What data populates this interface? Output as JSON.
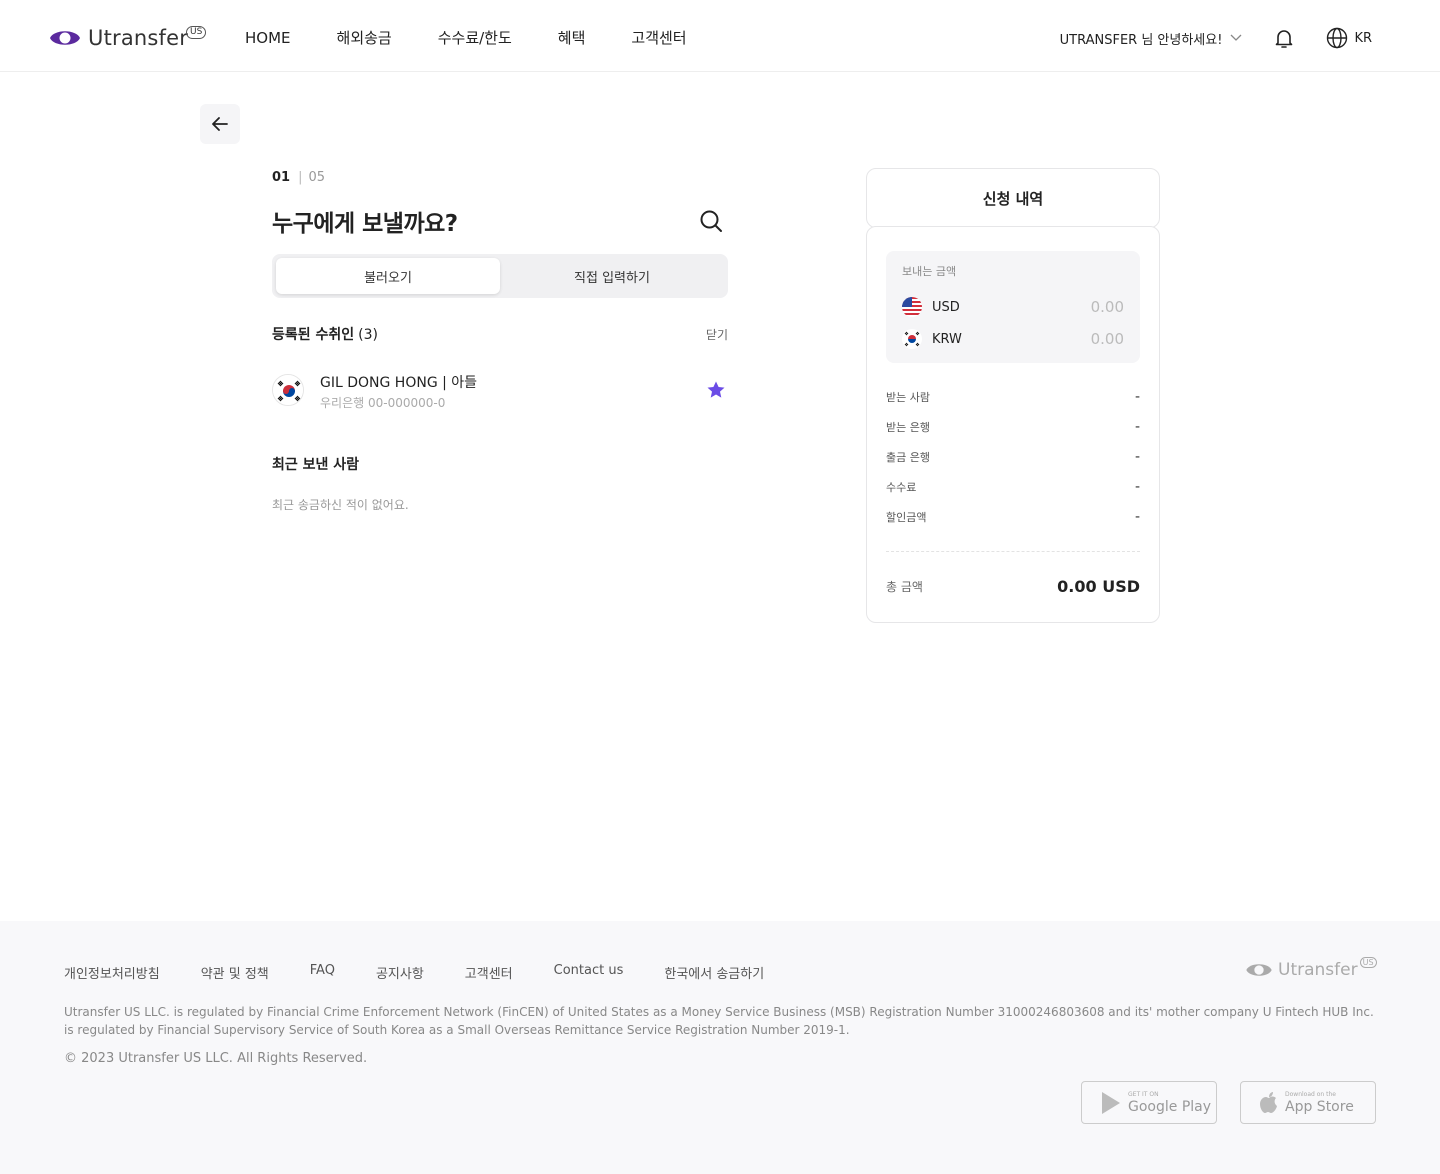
{
  "header": {
    "logo_text": "Utransfer",
    "logo_badge": "US",
    "nav": [
      "HOME",
      "해외송금",
      "수수료/한도",
      "혜택",
      "고객센터"
    ],
    "greeting": "UTRANSFER 님 안녕하세요!",
    "language": "KR"
  },
  "step": {
    "current": "01",
    "separator": "|",
    "total": "05"
  },
  "title": "누구에게 보낼까요?",
  "tabs": {
    "load": "불러오기",
    "manual": "직접 입력하기"
  },
  "registered": {
    "title": "등록된 수취인",
    "count": "(3)",
    "close_label": "닫기",
    "recipients": [
      {
        "name": "GIL DONG HONG | 아들",
        "bank": "우리은행 00-000000-0"
      }
    ]
  },
  "recent": {
    "title": "최근 보낸 사람",
    "empty": "최근 송금하신 적이 없어요."
  },
  "summary": {
    "title": "신청 내역",
    "send_amount_label": "보내는 금액",
    "currencies": [
      {
        "code": "USD",
        "amount": "0.00"
      },
      {
        "code": "KRW",
        "amount": "0.00"
      }
    ],
    "rows": [
      {
        "label": "받는 사람",
        "value": "-"
      },
      {
        "label": "받는 은행",
        "value": "-"
      },
      {
        "label": "출금 은행",
        "value": "-"
      },
      {
        "label": "수수료",
        "value": "-"
      },
      {
        "label": "할인금액",
        "value": "-"
      }
    ],
    "total_label": "총 금액",
    "total_value": "0.00 USD"
  },
  "footer": {
    "links": [
      "개인정보처리방침",
      "약관 및 정책",
      "FAQ",
      "공지사항",
      "고객센터",
      "Contact us",
      "한국에서 송금하기"
    ],
    "logo_text": "Utransfer",
    "logo_badge": "US",
    "legal": "Utransfer US LLC. is regulated by Financial Crime Enforcement Network (FinCEN) of United States as a Money Service Business (MSB) Registration Number 31000246803608 and its' mother company U Fintech HUB Inc. is regulated by Financial Supervisory Service of South Korea as a Small Overseas Remittance Service Registration Number 2019-1.",
    "copyright": "© 2023 Utransfer US LLC. All Rights Reserved.",
    "google_play_small": "GET IT ON",
    "google_play_big": "Google Play",
    "app_store_small": "Download on the",
    "app_store_big": "App Store"
  },
  "colors": {
    "brand": "#5b2a9e",
    "star": "#6b4ce6"
  }
}
